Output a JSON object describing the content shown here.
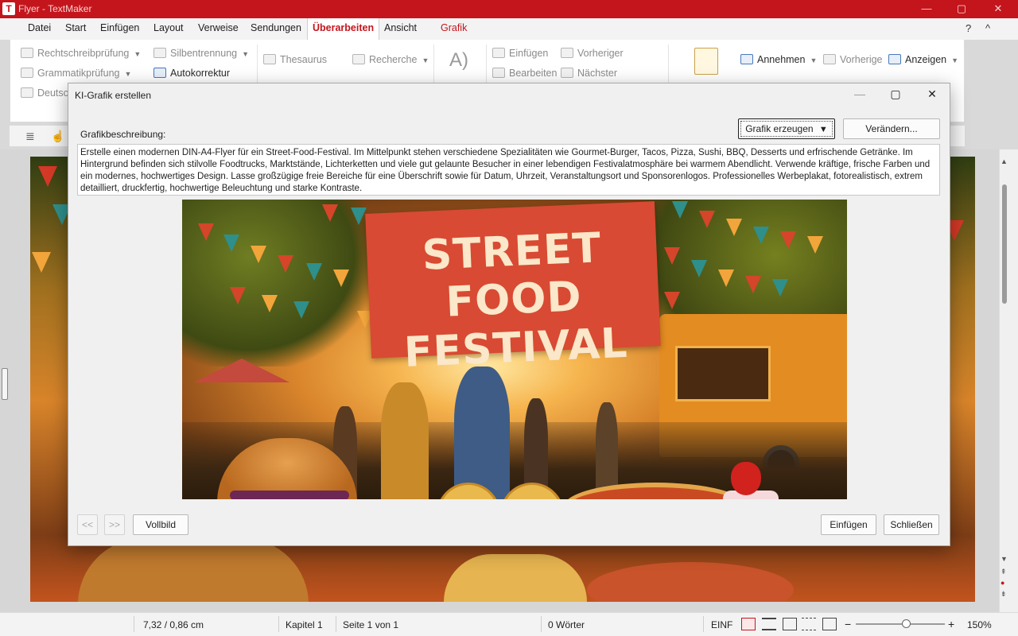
{
  "window": {
    "title": "Flyer - TextMaker",
    "app_icon": "T",
    "controls": [
      "—",
      "▢",
      "✕"
    ]
  },
  "menu": {
    "items": [
      "Datei",
      "Start",
      "Einfügen",
      "Layout",
      "Verweise",
      "Sendungen",
      "Überarbeiten",
      "Ansicht",
      "Grafik"
    ],
    "active": "Überarbeiten",
    "help": "?",
    "collapse": "^"
  },
  "ribbon": {
    "spelling": "Rechtschreibprüfung",
    "grammar": "Grammatikprüfung",
    "language": "Deutsc",
    "hyphenation": "Silbentrennung",
    "autocorrect": "Autokorrektur",
    "thesaurus": "Thesaurus",
    "research": "Recherche",
    "comment_insert": "Einfügen",
    "comment_edit": "Bearbeiten",
    "comment_prev": "Vorheriger",
    "comment_next": "Nächster",
    "accept": "Annehmen",
    "prev_change": "Vorherige",
    "show": "Anzeigen"
  },
  "dialog": {
    "title": "KI-Grafik erstellen",
    "label": "Grafikbeschreibung:",
    "generate_button": "Grafik erzeugen",
    "modify_button": "Verändern...",
    "prompt": "Erstelle einen modernen DIN-A4-Flyer für ein Street-Food-Festival. Im Mittelpunkt stehen verschiedene Spezialitäten wie Gourmet-Burger, Tacos, Pizza, Sushi, BBQ, Desserts und erfrischende Getränke. Im Hintergrund befinden sich stilvolle Foodtrucks, Marktstände, Lichterketten und viele gut gelaunte Besucher in einer lebendigen Festivalatmosphäre bei warmem Abendlicht. Verwende kräftige, frische Farben und ein modernes, hochwertiges Design. Lasse großzügige freie Bereiche für eine Überschrift sowie für Datum, Uhrzeit, Veranstaltungsort und Sponsorenlogos. Professionelles Werbeplakat, fotorealistisch, extrem detailliert, druckfertig, hochwertige Beleuchtung und starke Kontraste.",
    "image_banner_line1": "STREET FOOD",
    "image_banner_line2": "FESTIVAL",
    "prev_button": "<<",
    "next_button": ">>",
    "fullscreen_button": "Vollbild",
    "insert_button": "Einfügen",
    "close_button": "Schließen"
  },
  "status": {
    "position": "7,32 / 0,86 cm",
    "chapter": "Kapitel 1",
    "page": "Seite 1 von 1",
    "words": "0 Wörter",
    "mode": "EINF",
    "zoom": "150%",
    "zoom_minus": "−",
    "zoom_plus": "+"
  },
  "colors": {
    "brand_red": "#c4151c",
    "banner_red": "#d84a33"
  }
}
